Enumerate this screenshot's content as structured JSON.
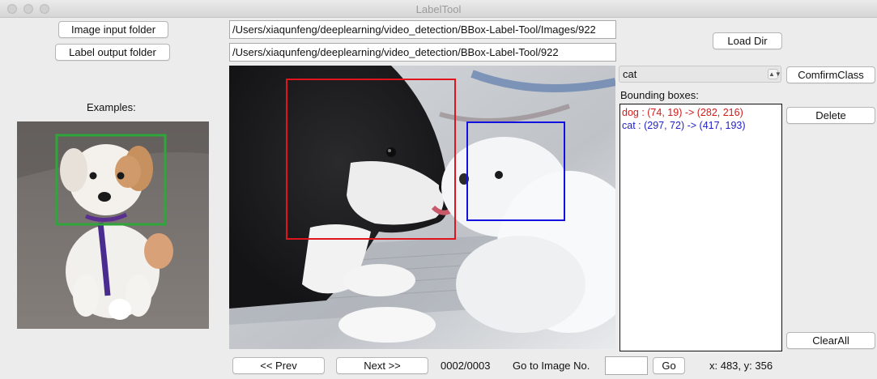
{
  "window": {
    "title": "LabelTool"
  },
  "buttons": {
    "image_input_folder": "Image input folder",
    "label_output_folder": "Label output folder",
    "load_dir": "Load Dir",
    "confirm_class": "ComfirmClass",
    "delete": "Delete",
    "clear_all": "ClearAll",
    "prev": "<< Prev",
    "next": "Next >>",
    "go": "Go"
  },
  "paths": {
    "image_dir": "/Users/xiaqunfeng/deeplearning/video_detection/BBox-Label-Tool/Images/922",
    "label_dir": "/Users/xiaqunfeng/deeplearning/video_detection/BBox-Label-Tool/922"
  },
  "examples": {
    "title": "Examples:"
  },
  "class_select": {
    "value": "cat"
  },
  "bboxes": {
    "title": "Bounding boxes:",
    "items": [
      {
        "text": "dog : (74, 19) -> (282, 216)",
        "color": "#d11a1a"
      },
      {
        "text": "cat : (297, 72) -> (417, 193)",
        "color": "#1f1fc8"
      }
    ]
  },
  "navigation": {
    "progress": "0002/0003",
    "goto_label": "Go to Image No.",
    "goto_value": "",
    "cursor_coords": "x: 483, y: 356"
  },
  "colors": {
    "dog_box": "#e0141c",
    "cat_box": "#1111e0",
    "example_box": "#2ea63a"
  },
  "icons": {
    "dropdown": "chevron-updown-icon",
    "close": "close-window-icon",
    "minimize": "minimize-window-icon",
    "zoom": "zoom-window-icon"
  }
}
